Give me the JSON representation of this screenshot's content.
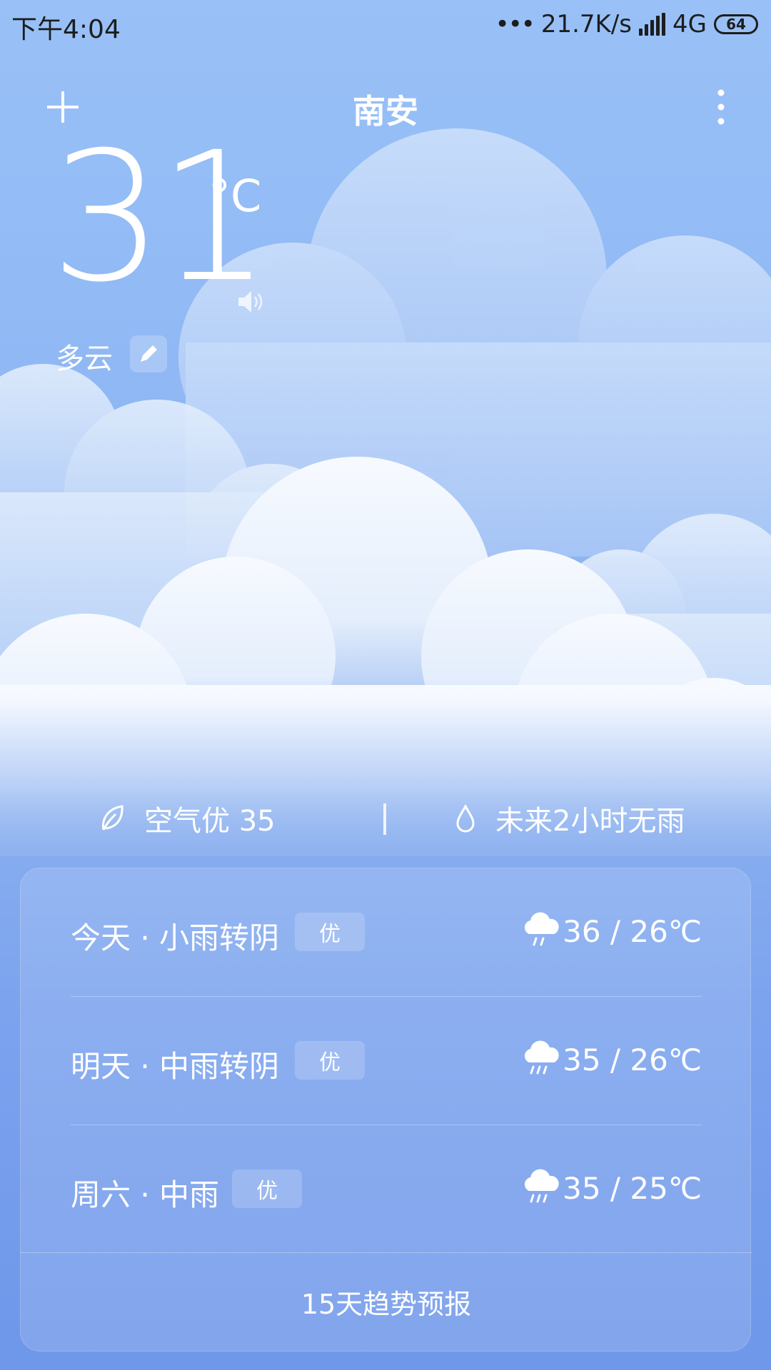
{
  "status_bar": {
    "time": "下午4:04",
    "dots": "•••",
    "network_speed": "21.7K/s",
    "network_type": "4G",
    "battery": "64",
    "icons": [
      "signal-icon",
      "battery-icon"
    ]
  },
  "header": {
    "city": "南安",
    "add_icon": "plus-icon",
    "more_icon": "more-vertical-icon"
  },
  "current": {
    "temperature": "31",
    "unit": "°C",
    "condition": "多云",
    "speaker_icon": "speaker-icon",
    "edit_icon": "pencil-icon"
  },
  "info": {
    "aqi_text": "空气优 35",
    "aqi_icon": "leaf-icon",
    "rain_text": "未来2小时无雨",
    "rain_icon": "drop-icon"
  },
  "forecast": [
    {
      "day_label": "今天 · 小雨转阴",
      "aqi": "优",
      "icon": "light-rain-icon",
      "temp_range": "36 / 26℃"
    },
    {
      "day_label": "明天 · 中雨转阴",
      "aqi": "优",
      "icon": "moderate-rain-icon",
      "temp_range": "35 / 26℃"
    },
    {
      "day_label": "周六 · 中雨",
      "aqi": "优",
      "icon": "moderate-rain-icon",
      "temp_range": "35 / 25℃"
    }
  ],
  "trend_link": "15天趋势预报",
  "colors": {
    "sky_top": "#99c1f7",
    "sky_bottom": "#6f97ea",
    "cloud": "#ffffff",
    "status_text": "#1d1d1d"
  }
}
